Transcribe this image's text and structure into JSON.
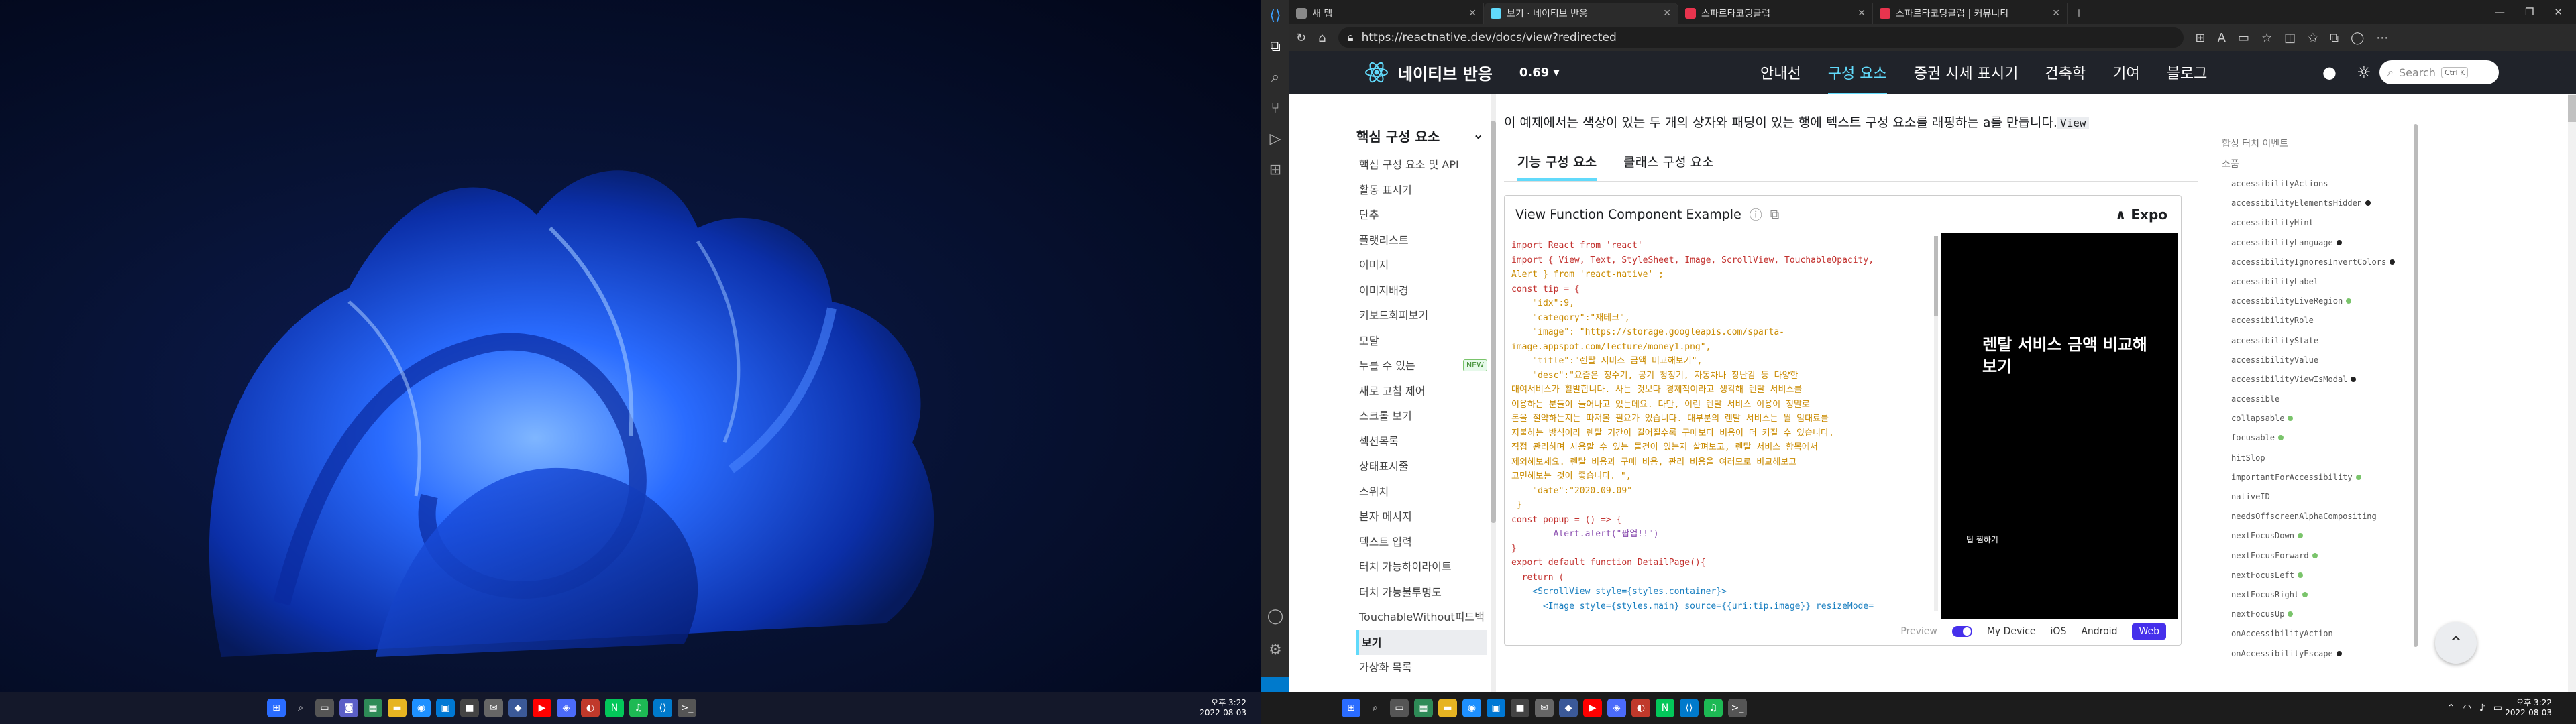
{
  "desktop": {
    "left_clock": {
      "time": "오후 3:22",
      "date": "2022-08-03"
    },
    "right_clock": {
      "time": "오후 3:22",
      "date": "2022-08-03"
    }
  },
  "browser": {
    "tabs": [
      {
        "label": "새 탭",
        "color": "#888888"
      },
      {
        "label": "보기 · 네이티브 반응",
        "color": "#61dafb"
      },
      {
        "label": "스파르타코딩클럽",
        "color": "#e8344e"
      },
      {
        "label": "스파르타코딩클럽 | 커뮤니티",
        "color": "#e8344e"
      }
    ],
    "url": "https://reactnative.dev/docs/view?redirected"
  },
  "site": {
    "logo_text": "네이티브 반응",
    "version": "0.69 ▾",
    "nav": [
      "안내선",
      "구성 요소",
      "증권 시세 표시기",
      "건축학",
      "기여",
      "블로그"
    ],
    "search_placeholder": "Search",
    "search_kbd": "Ctrl K"
  },
  "sidebar": {
    "heading": "핵심 구성 요소",
    "items": [
      "핵심 구성 요소 및 API",
      "활동 표시기",
      "단추",
      "플랫리스트",
      "이미지",
      "이미지배경",
      "키보드회피보기",
      "모달",
      "누를 수 있는",
      "새로 고침 제어",
      "스크롤 보기",
      "섹션목록",
      "상태표시줄",
      "스위치",
      "본자 메시지",
      "텍스트 입력",
      "터치 가능하이라이트",
      "터치 가능불투명도",
      "TouchableWithout피드백",
      "보기",
      "가상화 목록"
    ],
    "new_badge": "NEW"
  },
  "main": {
    "intro": "이 예제에서는 색상이 있는 두 개의 상자와 패딩이 있는 행에 텍스트 구성 요소를 래핑하는 a를 만듭니다.",
    "intro_code": "View",
    "tabs": [
      "기능 구성 요소",
      "클래스 구성 요소"
    ],
    "snack_title": "View Function Component Example",
    "expo": "Expo",
    "preview_title": "렌탈 서비스 금액 비교해보기",
    "preview_button": "팁 찜하기",
    "footer": {
      "preview": "Preview",
      "my_device": "My Device",
      "ios": "iOS",
      "android": "Android",
      "web": "Web"
    }
  },
  "toc": {
    "headings": [
      "합성 터치 이벤트",
      "소품"
    ],
    "items": [
      {
        "name": "accessibilityActions",
        "dot": ""
      },
      {
        "name": "accessibilityElementsHidden",
        "dot": "black"
      },
      {
        "name": "accessibilityHint",
        "dot": ""
      },
      {
        "name": "accessibilityLanguage",
        "dot": "black"
      },
      {
        "name": "accessibilityIgnoresInvertColors",
        "dot": "black"
      },
      {
        "name": "accessibilityLabel",
        "dot": ""
      },
      {
        "name": "accessibilityLiveRegion",
        "dot": "green"
      },
      {
        "name": "accessibilityRole",
        "dot": ""
      },
      {
        "name": "accessibilityState",
        "dot": ""
      },
      {
        "name": "accessibilityValue",
        "dot": ""
      },
      {
        "name": "accessibilityViewIsModal",
        "dot": "black"
      },
      {
        "name": "accessible",
        "dot": ""
      },
      {
        "name": "collapsable",
        "dot": "green"
      },
      {
        "name": "focusable",
        "dot": "green"
      },
      {
        "name": "hitSlop",
        "dot": ""
      },
      {
        "name": "importantForAccessibility",
        "dot": "green"
      },
      {
        "name": "nativeID",
        "dot": ""
      },
      {
        "name": "needsOffscreenAlphaCompositing",
        "dot": ""
      },
      {
        "name": "nextFocusDown",
        "dot": "green"
      },
      {
        "name": "nextFocusForward",
        "dot": "green"
      },
      {
        "name": "nextFocusLeft",
        "dot": "green"
      },
      {
        "name": "nextFocusRight",
        "dot": "green"
      },
      {
        "name": "nextFocusUp",
        "dot": "green"
      },
      {
        "name": "onAccessibilityAction",
        "dot": ""
      },
      {
        "name": "onAccessibilityEscape",
        "dot": "black"
      }
    ]
  },
  "code_lines": [
    "import React from 'react'",
    "import { View, Text, StyleSheet, Image, ScrollView, TouchableOpacity,",
    "Alert } from 'react-native' ;",
    "const tip = {",
    "    \"idx\":9,",
    "    \"category\":\"재테크\",",
    "    \"image\": \"https://storage.googleapis.com/sparta-",
    "image.appspot.com/lecture/money1.png\",",
    "    \"title\":\"렌탈 서비스 금액 비교해보기\",",
    "    \"desc\":\"요즘은 정수기, 공기 청정기, 자동차나 장난감 등 다양한",
    "대여서비스가 활발합니다. 사는 것보다 경제적이라고 생각해 렌탈 서비스를",
    "이용하는 분들이 늘어나고 있는데요. 다만, 이런 렌탈 서비스 이용이 정말로",
    "돈을 절약하는지는 따져볼 필요가 있습니다. 대부분의 렌탈 서비스는 월 임대료를",
    "지불하는 방식이라 렌탈 기간이 길어질수록 구매보다 비용이 더 커질 수 있습니다.",
    "직접 관리하며 사용할 수 있는 물건이 있는지 살펴보고, 렌탈 서비스 항목에서",
    "제외해보세요. 렌탈 비용과 구매 비용, 관리 비용을 여러모로 비교해보고",
    "고민해보는 것이 좋습니다. \",",
    "    \"date\":\"2020.09.09\"",
    " }",
    "const popup = () => {",
    "        Alert.alert(\"팝업!!\")",
    "}",
    "export default function DetailPage(){",
    "  return (",
    "    <ScrollView style={styles.container}>",
    "      <Image style={styles.main} source={{uri:tip.image}} resizeMode=",
    "  ..."
  ]
}
